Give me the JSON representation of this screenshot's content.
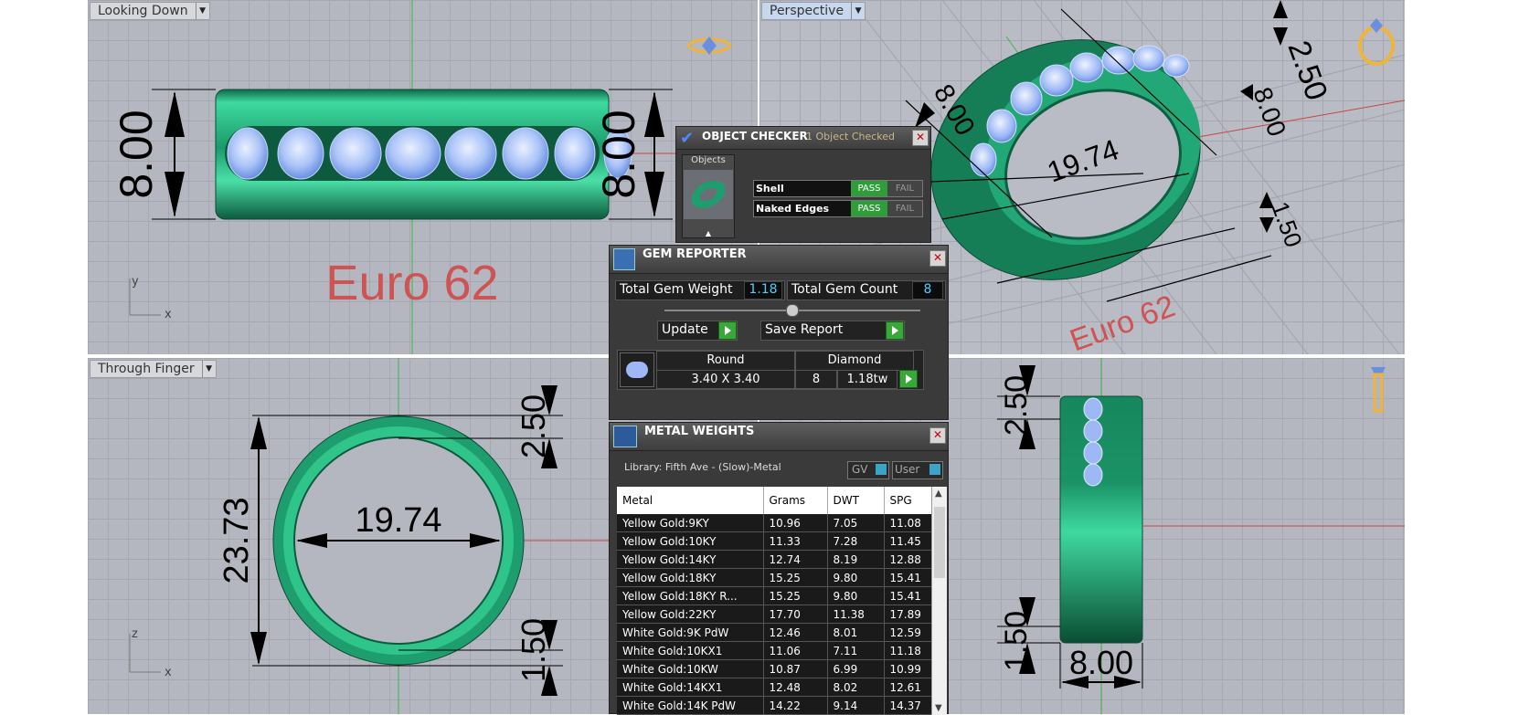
{
  "viewports": {
    "top_left": {
      "label": "Looking Down",
      "dims": {
        "height_left": "8.00",
        "height_right": "8.00"
      },
      "size_text": "Euro 62",
      "axis": {
        "a": "y",
        "b": "x"
      }
    },
    "top_right": {
      "label": "Perspective",
      "dims": {
        "a": "2.50",
        "b": "8.00",
        "c": "8.00",
        "d": "19.74",
        "e": "1.50"
      },
      "size_text": "Euro 62"
    },
    "bottom_left": {
      "label": "Through Finger",
      "dims": {
        "height": "23.73",
        "inner": "19.74",
        "top": "2.50",
        "bottom": "1.50"
      },
      "axis": {
        "a": "z",
        "b": "x"
      }
    },
    "bottom_right": {
      "dims": {
        "top": "2.50",
        "bottom": "1.50",
        "width": "8.00"
      }
    }
  },
  "object_checker": {
    "title": "OBJECT CHECKER",
    "status": "1  Object Checked",
    "objects_label": "Objects",
    "rows": [
      {
        "name": "Shell",
        "pass": "PASS",
        "fail": "FAIL"
      },
      {
        "name": "Naked Edges",
        "pass": "PASS",
        "fail": "FAIL"
      }
    ]
  },
  "gem_reporter": {
    "title": "GEM REPORTER",
    "total_weight_label": "Total Gem Weight",
    "total_weight": "1.18",
    "total_count_label": "Total Gem Count",
    "total_count": "8",
    "update_label": "Update",
    "save_label": "Save Report",
    "gem": {
      "shape": "Round",
      "type": "Diamond",
      "size": "3.40 X 3.40",
      "count": "8",
      "weight": "1.18tw"
    }
  },
  "metal_weights": {
    "title": "METAL WEIGHTS",
    "library": "Library: Fifth Ave - (Slow)-Metal",
    "gv_label": "GV",
    "user_label": "User",
    "columns": [
      "Metal",
      "Grams",
      "DWT",
      "SPG"
    ],
    "rows": [
      [
        "Yellow Gold:9KY",
        "10.96",
        "7.05",
        "11.08"
      ],
      [
        "Yellow Gold:10KY",
        "11.33",
        "7.28",
        "11.45"
      ],
      [
        "Yellow Gold:14KY",
        "12.74",
        "8.19",
        "12.88"
      ],
      [
        "Yellow Gold:18KY",
        "15.25",
        "9.80",
        "15.41"
      ],
      [
        "Yellow Gold:18KY R...",
        "15.25",
        "9.80",
        "15.41"
      ],
      [
        "Yellow Gold:22KY",
        "17.70",
        "11.38",
        "17.89"
      ],
      [
        "White Gold:9K PdW",
        "12.46",
        "8.01",
        "12.59"
      ],
      [
        "White Gold:10KX1",
        "11.06",
        "7.11",
        "11.18"
      ],
      [
        "White Gold:10KW",
        "10.87",
        "6.99",
        "10.99"
      ],
      [
        "White Gold:14KX1",
        "12.48",
        "8.02",
        "12.61"
      ],
      [
        "White Gold:14K PdW",
        "14.22",
        "9.14",
        "14.37"
      ]
    ]
  },
  "colors": {
    "ring_green": "#1e9e6e",
    "gem_blue": "#9db8f5",
    "panel_dark": "#3a3a3a",
    "pass_green": "#2f9e3a",
    "label_red": "#d05353"
  }
}
